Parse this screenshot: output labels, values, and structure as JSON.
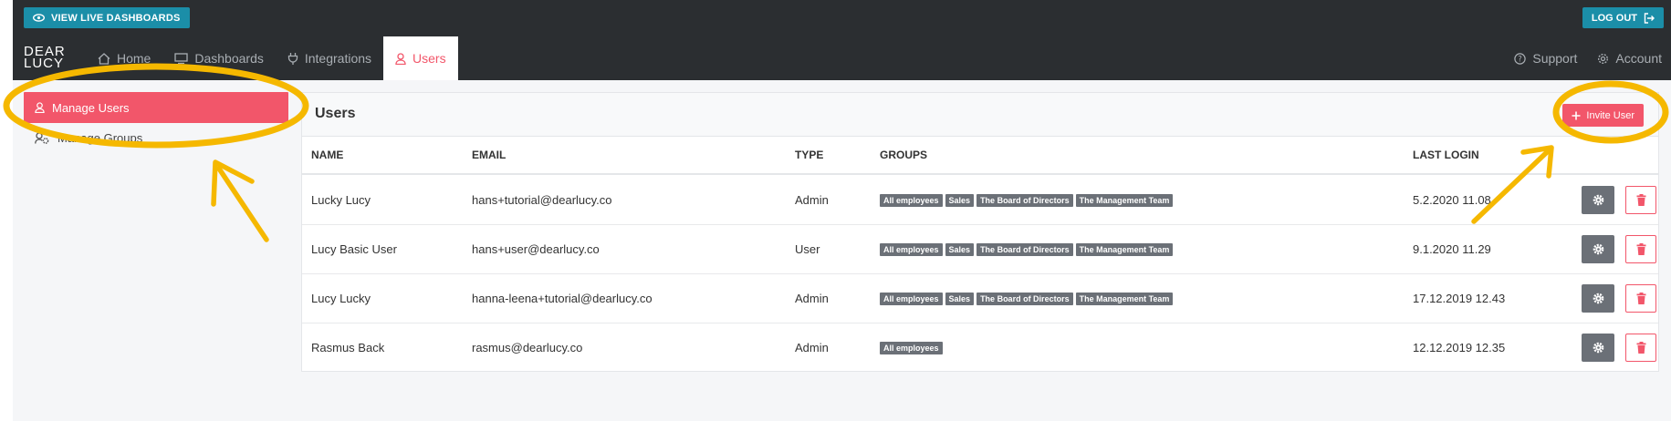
{
  "topbar": {
    "live_label": "VIEW LIVE DASHBOARDS",
    "logout_label": "LOG OUT",
    "logo_line1": "DEAR",
    "logo_line2": "LUCY"
  },
  "nav": {
    "items": [
      {
        "label": "Home",
        "icon": "home-icon"
      },
      {
        "label": "Dashboards",
        "icon": "monitor-icon"
      },
      {
        "label": "Integrations",
        "icon": "plug-icon"
      },
      {
        "label": "Users",
        "icon": "user-icon",
        "active": true
      }
    ],
    "support_label": "Support",
    "account_label": "Account"
  },
  "sidebar": {
    "items": [
      {
        "label": "Manage Users",
        "icon": "user-icon",
        "active": true
      },
      {
        "label": "Manage Groups",
        "icon": "users-gear-icon"
      }
    ]
  },
  "panel": {
    "title": "Users",
    "invite_label": "Invite User",
    "columns": [
      "NAME",
      "EMAIL",
      "TYPE",
      "GROUPS",
      "LAST LOGIN"
    ],
    "rows": [
      {
        "name": "Lucky Lucy",
        "email": "hans+tutorial@dearlucy.co",
        "type": "Admin",
        "groups": [
          "All employees",
          "Sales",
          "The Board of Directors",
          "The Management Team"
        ],
        "last_login": "5.2.2020 11.08"
      },
      {
        "name": "Lucy Basic User",
        "email": "hans+user@dearlucy.co",
        "type": "User",
        "groups": [
          "All employees",
          "Sales",
          "The Board of Directors",
          "The Management Team"
        ],
        "last_login": "9.1.2020 11.29"
      },
      {
        "name": "Lucy Lucky",
        "email": "hanna-leena+tutorial@dearlucy.co",
        "type": "Admin",
        "groups": [
          "All employees",
          "Sales",
          "The Board of Directors",
          "The Management Team"
        ],
        "last_login": "17.12.2019 12.43"
      },
      {
        "name": "Rasmus Back",
        "email": "rasmus@dearlucy.co",
        "type": "Admin",
        "groups": [
          "All employees"
        ],
        "last_login": "12.12.2019 12.35"
      }
    ]
  },
  "colors": {
    "accent": "#f2566a",
    "teal": "#1b8ea8",
    "dark": "#2b2e31",
    "annotation": "#f5b800"
  }
}
